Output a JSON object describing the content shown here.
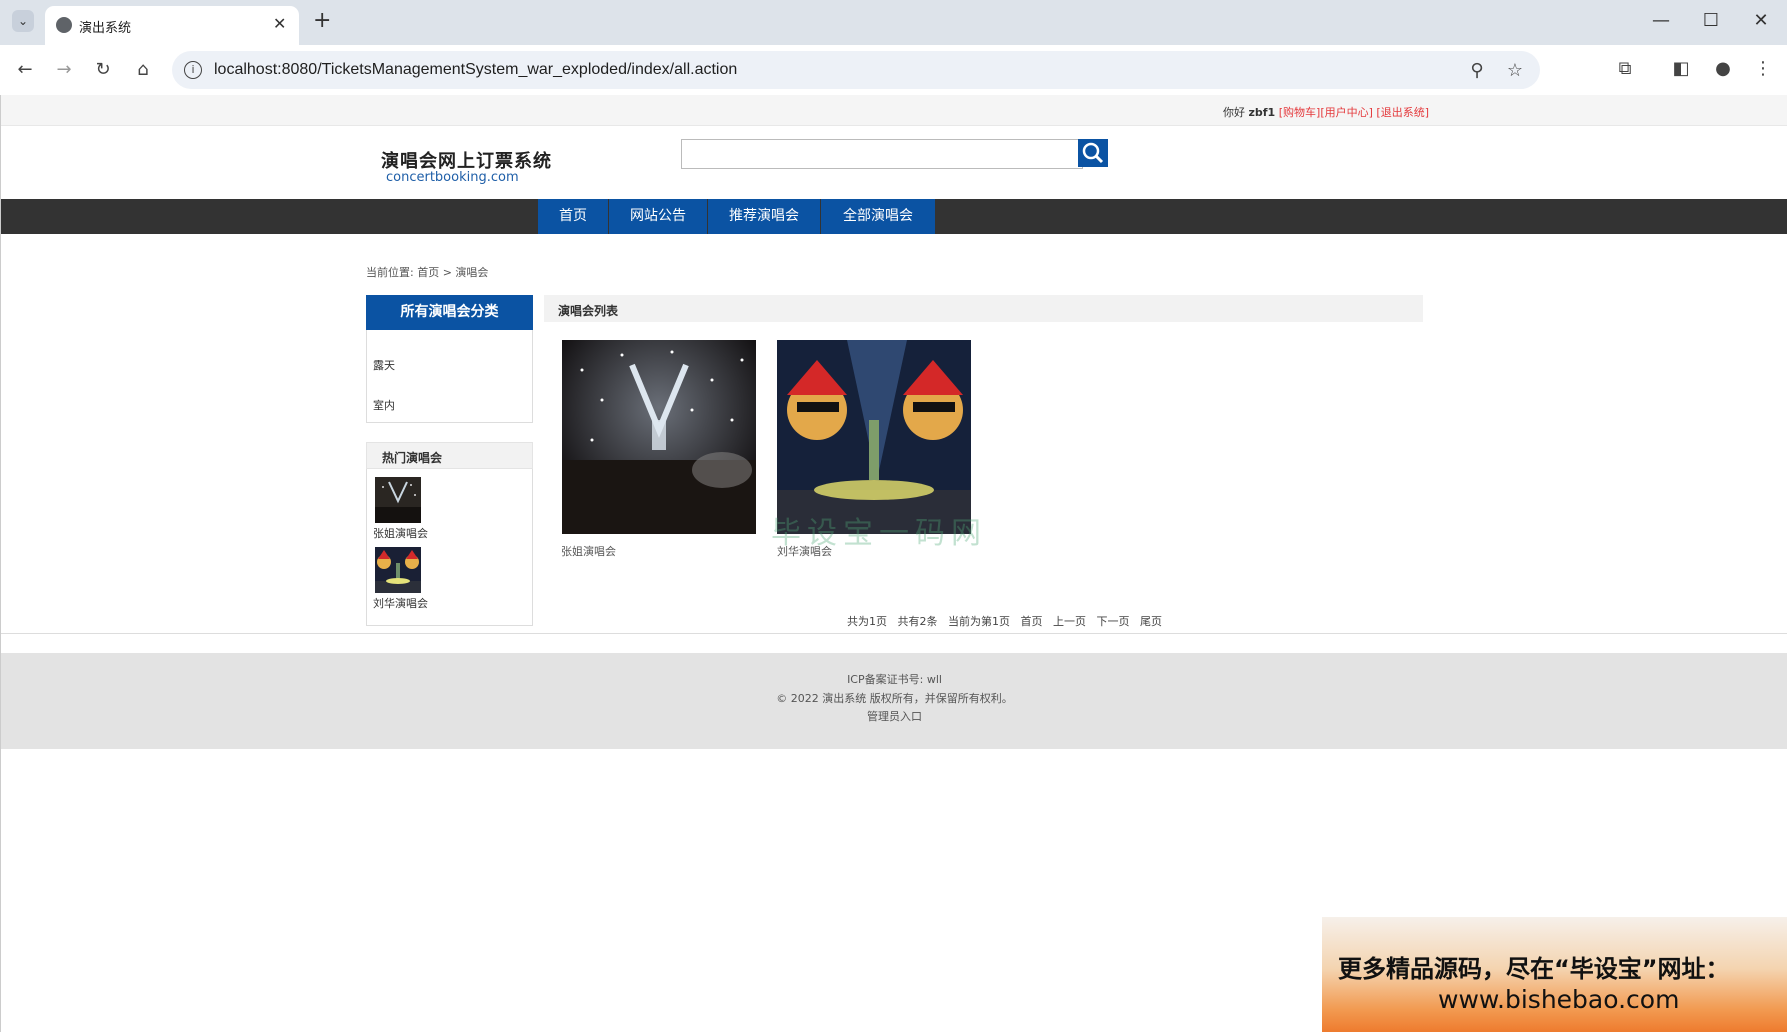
{
  "browser": {
    "tab_title": "演出系统",
    "new_tab": "+",
    "url": "localhost:8080/TicketsManagementSystem_war_exploded/index/all.action"
  },
  "topbar": {
    "greeting": "你好",
    "username": "zbf1",
    "cart": "[购物车]",
    "user_center": "[用户中心]",
    "logout": "[退出系统]"
  },
  "logo": {
    "cn": "演唱会网上订票系统",
    "en": "concertbooking.com"
  },
  "search": {
    "placeholder": ""
  },
  "nav": [
    "首页",
    "网站公告",
    "推荐演唱会",
    "全部演唱会"
  ],
  "breadcrumb": "当前位置: 首页 > 演唱会",
  "sidebar": {
    "category_title": "所有演唱会分类",
    "categories": [
      "露天",
      "室内"
    ],
    "hot_title": "热门演唱会",
    "hot_items": [
      "张姐演唱会",
      "刘华演唱会"
    ]
  },
  "list": {
    "title": "演唱会列表",
    "items": [
      "张姐演唱会",
      "刘华演唱会"
    ]
  },
  "pager": {
    "total_pages": "共为1页",
    "total_items": "共有2条",
    "current": "当前为第1页",
    "first": "首页",
    "prev": "上一页",
    "next": "下一页",
    "last": "尾页"
  },
  "footer": {
    "icp": "ICP备案证书号: wll",
    "copyright": "© 2022 演出系统 版权所有，并保留所有权利。",
    "admin": "管理员入口"
  },
  "banner": {
    "line1": "更多精品源码，尽在“毕设宝”网址：",
    "line2": "www.bishebao.com"
  },
  "watermark": "毕设宝一码网",
  "colors": {
    "brand_blue": "#0b53a3",
    "nav_dark": "#333333",
    "link_red": "#e4393c"
  }
}
